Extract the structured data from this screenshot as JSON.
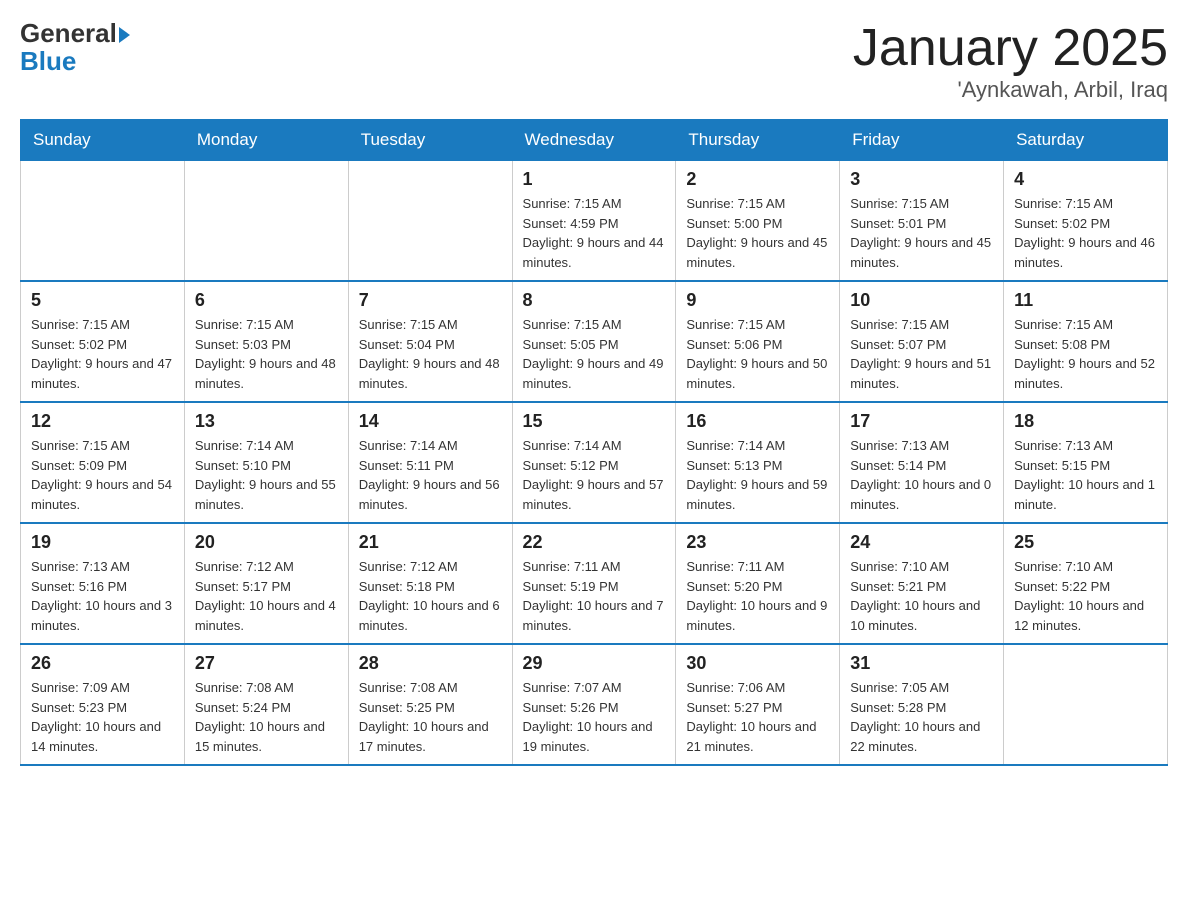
{
  "logo": {
    "general": "General",
    "arrow": "▶",
    "blue": "Blue"
  },
  "title": "January 2025",
  "subtitle": "'Aynkawah, Arbil, Iraq",
  "days_of_week": [
    "Sunday",
    "Monday",
    "Tuesday",
    "Wednesday",
    "Thursday",
    "Friday",
    "Saturday"
  ],
  "weeks": [
    [
      {
        "day": "",
        "info": ""
      },
      {
        "day": "",
        "info": ""
      },
      {
        "day": "",
        "info": ""
      },
      {
        "day": "1",
        "info": "Sunrise: 7:15 AM\nSunset: 4:59 PM\nDaylight: 9 hours and 44 minutes."
      },
      {
        "day": "2",
        "info": "Sunrise: 7:15 AM\nSunset: 5:00 PM\nDaylight: 9 hours and 45 minutes."
      },
      {
        "day": "3",
        "info": "Sunrise: 7:15 AM\nSunset: 5:01 PM\nDaylight: 9 hours and 45 minutes."
      },
      {
        "day": "4",
        "info": "Sunrise: 7:15 AM\nSunset: 5:02 PM\nDaylight: 9 hours and 46 minutes."
      }
    ],
    [
      {
        "day": "5",
        "info": "Sunrise: 7:15 AM\nSunset: 5:02 PM\nDaylight: 9 hours and 47 minutes."
      },
      {
        "day": "6",
        "info": "Sunrise: 7:15 AM\nSunset: 5:03 PM\nDaylight: 9 hours and 48 minutes."
      },
      {
        "day": "7",
        "info": "Sunrise: 7:15 AM\nSunset: 5:04 PM\nDaylight: 9 hours and 48 minutes."
      },
      {
        "day": "8",
        "info": "Sunrise: 7:15 AM\nSunset: 5:05 PM\nDaylight: 9 hours and 49 minutes."
      },
      {
        "day": "9",
        "info": "Sunrise: 7:15 AM\nSunset: 5:06 PM\nDaylight: 9 hours and 50 minutes."
      },
      {
        "day": "10",
        "info": "Sunrise: 7:15 AM\nSunset: 5:07 PM\nDaylight: 9 hours and 51 minutes."
      },
      {
        "day": "11",
        "info": "Sunrise: 7:15 AM\nSunset: 5:08 PM\nDaylight: 9 hours and 52 minutes."
      }
    ],
    [
      {
        "day": "12",
        "info": "Sunrise: 7:15 AM\nSunset: 5:09 PM\nDaylight: 9 hours and 54 minutes."
      },
      {
        "day": "13",
        "info": "Sunrise: 7:14 AM\nSunset: 5:10 PM\nDaylight: 9 hours and 55 minutes."
      },
      {
        "day": "14",
        "info": "Sunrise: 7:14 AM\nSunset: 5:11 PM\nDaylight: 9 hours and 56 minutes."
      },
      {
        "day": "15",
        "info": "Sunrise: 7:14 AM\nSunset: 5:12 PM\nDaylight: 9 hours and 57 minutes."
      },
      {
        "day": "16",
        "info": "Sunrise: 7:14 AM\nSunset: 5:13 PM\nDaylight: 9 hours and 59 minutes."
      },
      {
        "day": "17",
        "info": "Sunrise: 7:13 AM\nSunset: 5:14 PM\nDaylight: 10 hours and 0 minutes."
      },
      {
        "day": "18",
        "info": "Sunrise: 7:13 AM\nSunset: 5:15 PM\nDaylight: 10 hours and 1 minute."
      }
    ],
    [
      {
        "day": "19",
        "info": "Sunrise: 7:13 AM\nSunset: 5:16 PM\nDaylight: 10 hours and 3 minutes."
      },
      {
        "day": "20",
        "info": "Sunrise: 7:12 AM\nSunset: 5:17 PM\nDaylight: 10 hours and 4 minutes."
      },
      {
        "day": "21",
        "info": "Sunrise: 7:12 AM\nSunset: 5:18 PM\nDaylight: 10 hours and 6 minutes."
      },
      {
        "day": "22",
        "info": "Sunrise: 7:11 AM\nSunset: 5:19 PM\nDaylight: 10 hours and 7 minutes."
      },
      {
        "day": "23",
        "info": "Sunrise: 7:11 AM\nSunset: 5:20 PM\nDaylight: 10 hours and 9 minutes."
      },
      {
        "day": "24",
        "info": "Sunrise: 7:10 AM\nSunset: 5:21 PM\nDaylight: 10 hours and 10 minutes."
      },
      {
        "day": "25",
        "info": "Sunrise: 7:10 AM\nSunset: 5:22 PM\nDaylight: 10 hours and 12 minutes."
      }
    ],
    [
      {
        "day": "26",
        "info": "Sunrise: 7:09 AM\nSunset: 5:23 PM\nDaylight: 10 hours and 14 minutes."
      },
      {
        "day": "27",
        "info": "Sunrise: 7:08 AM\nSunset: 5:24 PM\nDaylight: 10 hours and 15 minutes."
      },
      {
        "day": "28",
        "info": "Sunrise: 7:08 AM\nSunset: 5:25 PM\nDaylight: 10 hours and 17 minutes."
      },
      {
        "day": "29",
        "info": "Sunrise: 7:07 AM\nSunset: 5:26 PM\nDaylight: 10 hours and 19 minutes."
      },
      {
        "day": "30",
        "info": "Sunrise: 7:06 AM\nSunset: 5:27 PM\nDaylight: 10 hours and 21 minutes."
      },
      {
        "day": "31",
        "info": "Sunrise: 7:05 AM\nSunset: 5:28 PM\nDaylight: 10 hours and 22 minutes."
      },
      {
        "day": "",
        "info": ""
      }
    ]
  ]
}
